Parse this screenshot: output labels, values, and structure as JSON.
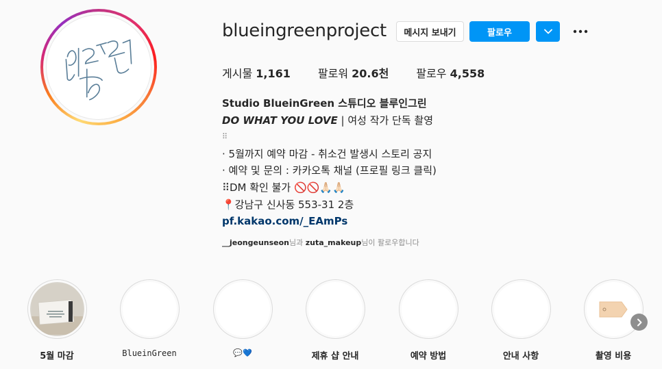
{
  "profile": {
    "username": "blueingreenproject",
    "message_button": "메시지 보내기",
    "follow_button": "팔로우",
    "stats": {
      "posts_label": "게시물",
      "posts_value": "1,161",
      "followers_label": "팔로워",
      "followers_value": "20.6천",
      "following_label": "팔로우",
      "following_value": "4,558"
    },
    "bio": {
      "name": "Studio BlueinGreen 스튜디오 블루인그린",
      "tagline_em": "DO WHAT YOU LOVE",
      "tagline_rest": " | 여성 작가 단독 촬영",
      "dots": "⠿",
      "line1": " · 5월까지 예약 마감 - 취소건 발생시 스토리 공지",
      "line2": " · 예약 및 문의 : 카카오톡 채널 (프로필 링크 클릭)",
      "line3": "⠿DM 확인 불가 🚫🚫🙏🏻🙏🏻",
      "line4": "📍강남구 신사동 553-31 2층",
      "link": "pf.kakao.com/_EAmPs"
    },
    "followed_by": {
      "user1": "__jeongeunseon",
      "mid": "님과 ",
      "user2": "zuta_makeup",
      "end": "님이 팔로우합니다"
    }
  },
  "highlights": [
    {
      "label": "5월 마감"
    },
    {
      "label": "BlueinGreen"
    },
    {
      "label": "💬💙"
    },
    {
      "label": "제휴 샵 안내"
    },
    {
      "label": "예약 방법"
    },
    {
      "label": "안내 사항"
    },
    {
      "label": "촬영 비용"
    }
  ],
  "colors": {
    "accent": "#0095f6",
    "link": "#00376b",
    "muted": "#8e8e8e"
  }
}
